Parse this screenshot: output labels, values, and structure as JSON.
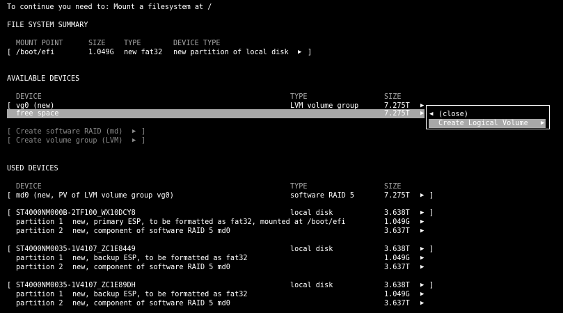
{
  "header": {
    "prompt": "To continue you need to: Mount a filesystem at /"
  },
  "fs_summary": {
    "heading": "FILE SYSTEM SUMMARY",
    "columns": [
      "MOUNT POINT",
      "SIZE",
      "TYPE",
      "DEVICE TYPE"
    ],
    "rows": [
      {
        "mount": "/boot/efi",
        "size": "1.049G",
        "type": "new fat32",
        "device_type": "new partition of local disk"
      }
    ]
  },
  "available": {
    "heading": "AVAILABLE DEVICES",
    "columns": [
      "DEVICE",
      "TYPE",
      "SIZE"
    ],
    "vg": {
      "device": "vg0 (new)",
      "type": "LVM volume group",
      "size": "7.275T"
    },
    "free": {
      "device": "free space",
      "size": "7.275T"
    },
    "actions": [
      "Create software RAID (md)",
      "Create volume group (LVM)"
    ]
  },
  "popup": {
    "close_label": "(close)",
    "create_lv_label": "Create Logical Volume"
  },
  "used": {
    "heading": "USED DEVICES",
    "columns": [
      "DEVICE",
      "TYPE",
      "SIZE"
    ],
    "md0": {
      "device": "md0 (new, PV of LVM volume group vg0)",
      "type": "software RAID 5",
      "size": "7.275T"
    },
    "disks": [
      {
        "name": "ST4000NM000B-2TF100_WX10DCY8",
        "type": "local disk",
        "size": "3.638T",
        "partitions": [
          {
            "label": "partition 1",
            "desc": "new, primary ESP, to be formatted as fat32, mounted at /boot/efi",
            "size": "1.049G"
          },
          {
            "label": "partition 2",
            "desc": "new, component of software RAID 5 md0",
            "size": "3.637T"
          }
        ]
      },
      {
        "name": "ST4000NM0035-1V4107_ZC1E8449",
        "type": "local disk",
        "size": "3.638T",
        "partitions": [
          {
            "label": "partition 1",
            "desc": "new, backup ESP, to be formatted as fat32",
            "size": "1.049G"
          },
          {
            "label": "partition 2",
            "desc": "new, component of software RAID 5 md0",
            "size": "3.637T"
          }
        ]
      },
      {
        "name": "ST4000NM0035-1V4107_ZC1E89DH",
        "type": "local disk",
        "size": "3.638T",
        "partitions": [
          {
            "label": "partition 1",
            "desc": "new, backup ESP, to be formatted as fat32",
            "size": "1.049G"
          },
          {
            "label": "partition 2",
            "desc": "new, component of software RAID 5 md0",
            "size": "3.637T"
          }
        ]
      }
    ]
  }
}
